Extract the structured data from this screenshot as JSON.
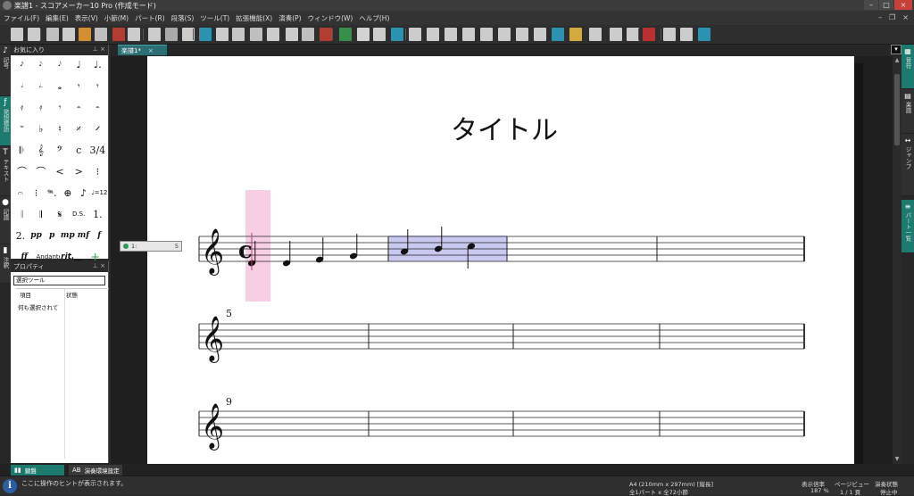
{
  "window": {
    "title": "楽譜1 - スコアメーカー10 Pro (作成モード)"
  },
  "menu": [
    "ファイル(F)",
    "編集(E)",
    "表示(V)",
    "小節(M)",
    "パート(R)",
    "段落(S)",
    "ツール(T)",
    "拡張機能(X)",
    "演奏(P)",
    "ウィンドウ(W)",
    "ヘルプ(H)"
  ],
  "left_tabs": [
    {
      "icon": "♪",
      "label": "記号"
    },
    {
      "icon": "ƒ",
      "label": "発想標語"
    },
    {
      "icon": "T",
      "label": "テキスト"
    },
    {
      "icon": "●",
      "label": "記譜"
    },
    {
      "icon": "▮",
      "label": "注釈"
    }
  ],
  "favorites": {
    "title": "お気に入り",
    "rows": [
      [
        "𝅘𝅥𝅯",
        "𝅘𝅥𝅮",
        "𝅘𝅥𝅮",
        "♩",
        "♩."
      ],
      [
        "𝅗𝅥",
        "𝅗𝅥.",
        "𝅝",
        "𝄾",
        "𝄾"
      ],
      [
        "𝄿",
        "𝄿",
        "𝄾",
        "𝄼",
        "𝄼"
      ],
      [
        "𝄻",
        "♭",
        "♮",
        "𝄎",
        "𝄍"
      ],
      [
        "𝄆",
        "𝄞",
        "𝄢",
        "c",
        "3/4"
      ],
      [
        "⌒",
        "⌒",
        "<",
        ">",
        "⁝"
      ],
      [
        "𝄐",
        "⁝",
        "𝆮.",
        "⊕",
        "♪",
        "♩=120"
      ],
      [
        "𝄁",
        "𝄂",
        "𝄋",
        "D.S.",
        "1."
      ],
      [
        "2.",
        "pp",
        "p",
        "mp",
        "mf",
        "f"
      ],
      [
        "ff",
        "Andante",
        "rit.__",
        "+"
      ]
    ]
  },
  "properties": {
    "title": "プロパティ",
    "tool": "選択ツール",
    "col_item": "項目",
    "col_state": "状態",
    "value": "何も選択されて"
  },
  "document": {
    "tab_label": "楽譜1*",
    "tab_close": "×",
    "score_title": "タイトル",
    "part_label": "1:",
    "part_count": "5",
    "measure_numbers": [
      "5",
      "9"
    ],
    "time_signature": "c"
  },
  "right_tabs": [
    {
      "icon": "▦",
      "label": "音符"
    },
    {
      "icon": "▤",
      "label": "楽譜"
    },
    {
      "icon": "↔",
      "label": "ジャンプ"
    },
    {
      "icon": "≡",
      "label": "パート一覧"
    }
  ],
  "bottom_tabs": [
    {
      "icon": "▮▮",
      "label": "鍵盤"
    },
    {
      "icon": "AB",
      "label": "演奏環境設定"
    }
  ],
  "status": {
    "hint": "ここに操作のヒントが表示されます。",
    "paper": "A4 (210mm x 297mm) [縦長]",
    "parts": "全1パート x 全72小節",
    "zoom_label": "表示倍率",
    "zoom_value": "187 %",
    "page_label": "ページビュー",
    "page_value": "1 /   1 頁",
    "play_label": "演奏状態",
    "play_value": "停止中"
  },
  "colors": {
    "accent": "#1d7a6e",
    "selection": "#c8c8f0",
    "cursor_pink": "#f7c6e0"
  }
}
